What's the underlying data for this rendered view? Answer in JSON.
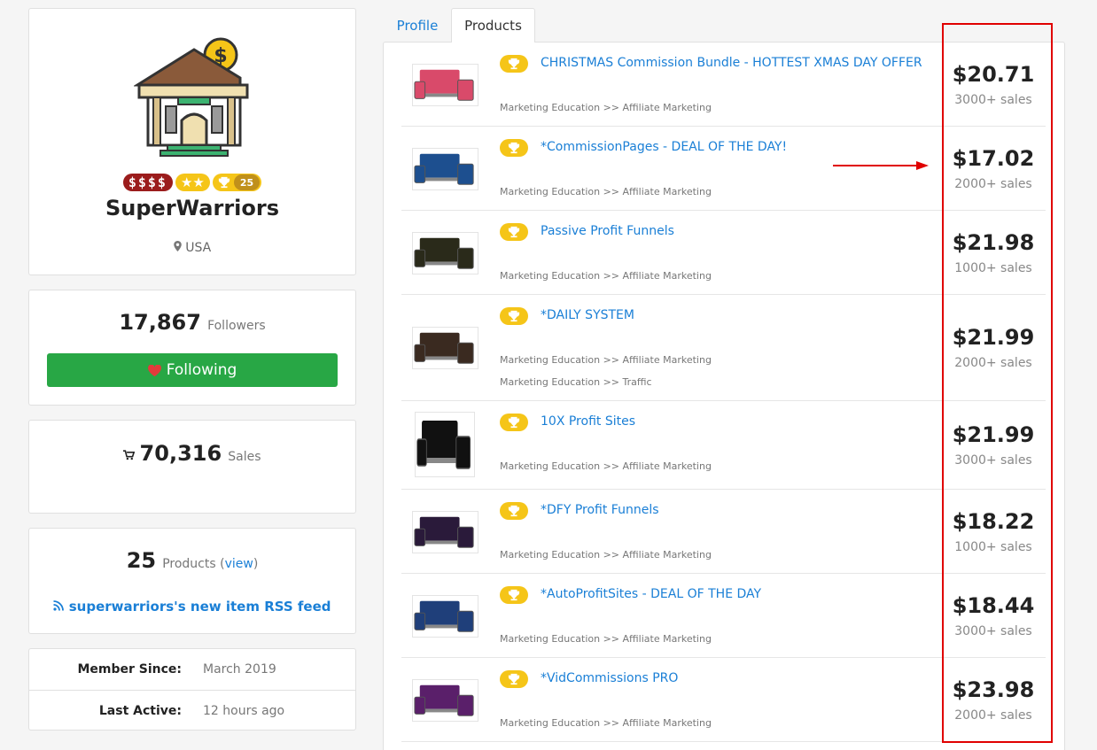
{
  "profile": {
    "username": "SuperWarriors",
    "location": "USA",
    "badges": {
      "money": "$$$$",
      "stars": "★★",
      "trophy_count": "25"
    }
  },
  "followers": {
    "count": "17,867",
    "label": "Followers",
    "button_label": "Following"
  },
  "sales": {
    "count": "70,316",
    "label": "Sales"
  },
  "products_summary": {
    "count": "25",
    "label": "Products",
    "view_open": "(",
    "view_label": "view",
    "view_close": ")",
    "rss_label": "superwarriors's new item RSS feed"
  },
  "meta": {
    "member_since_label": "Member Since:",
    "member_since_value": "March 2019",
    "last_active_label": "Last Active:",
    "last_active_value": "12 hours ago"
  },
  "tabs": [
    {
      "label": "Profile"
    },
    {
      "label": "Products"
    }
  ],
  "products": [
    {
      "title": "CHRISTMAS Commission Bundle - HOTTEST XMAS DAY OFFER",
      "categories": [
        "Marketing Education >> Affiliate Marketing"
      ],
      "price": "$20.71",
      "sales": "3000+ sales",
      "thumb_color": "#d94a6a"
    },
    {
      "title": "*CommissionPages - DEAL OF THE DAY!",
      "categories": [
        "Marketing Education >> Affiliate Marketing"
      ],
      "price": "$17.02",
      "sales": "2000+ sales",
      "thumb_color": "#1d4f8f"
    },
    {
      "title": "Passive Profit Funnels",
      "categories": [
        "Marketing Education >> Affiliate Marketing"
      ],
      "price": "$21.98",
      "sales": "1000+ sales",
      "thumb_color": "#2a2a1a"
    },
    {
      "title": "*DAILY SYSTEM",
      "categories": [
        "Marketing Education >> Affiliate Marketing",
        "Marketing Education >> Traffic"
      ],
      "price": "$21.99",
      "sales": "2000+ sales",
      "thumb_color": "#3a2a20"
    },
    {
      "title": "10X Profit Sites",
      "categories": [
        "Marketing Education >> Affiliate Marketing"
      ],
      "price": "$21.99",
      "sales": "3000+ sales",
      "thumb_color": "#111111"
    },
    {
      "title": "*DFY Profit Funnels",
      "categories": [
        "Marketing Education >> Affiliate Marketing"
      ],
      "price": "$18.22",
      "sales": "1000+ sales",
      "thumb_color": "#2a1a3a"
    },
    {
      "title": "*AutoProfitSites - DEAL OF THE DAY",
      "categories": [
        "Marketing Education >> Affiliate Marketing"
      ],
      "price": "$18.44",
      "sales": "3000+ sales",
      "thumb_color": "#1f3f7a"
    },
    {
      "title": "*VidCommissions PRO",
      "categories": [
        "Marketing Education >> Affiliate Marketing"
      ],
      "price": "$23.98",
      "sales": "2000+ sales",
      "thumb_color": "#5a1f6a"
    }
  ]
}
